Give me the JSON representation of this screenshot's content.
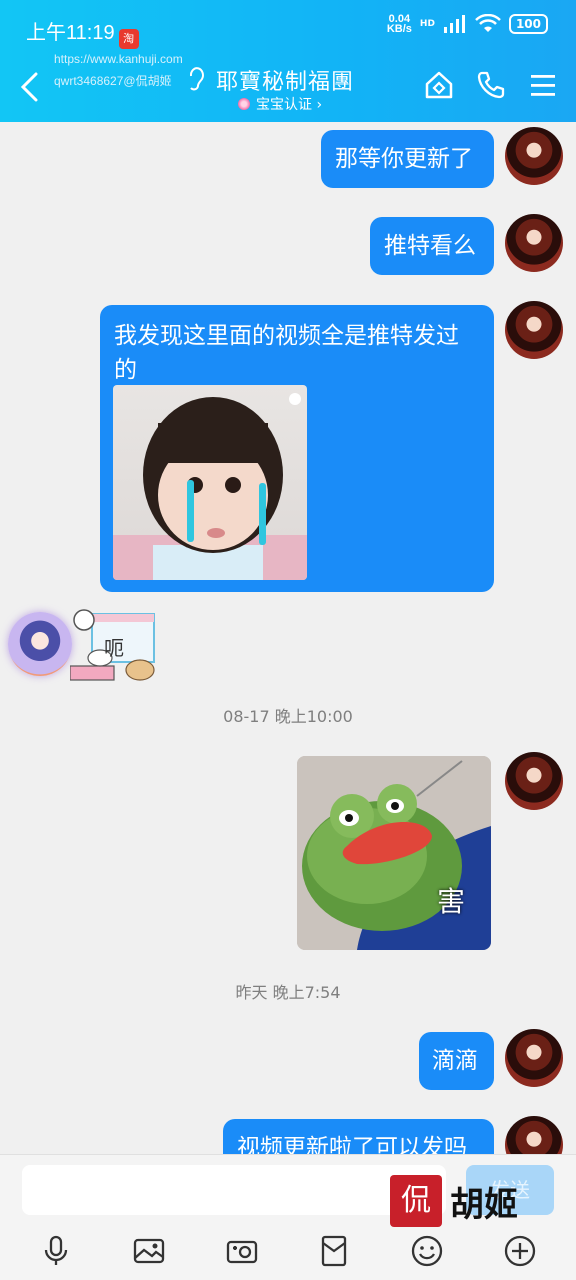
{
  "status_bar": {
    "time": "上午11:19",
    "badge": "淘",
    "net_speed_value": "0.04",
    "net_speed_unit": "KB/s",
    "signal_label": "HD",
    "battery": "100"
  },
  "watermark": {
    "url": "https://www.kanhuji.com",
    "user": "qwrt3468627@侃胡姬"
  },
  "header": {
    "title": "耶寶秘制福團",
    "subtitle": "宝宝认证 ›"
  },
  "messages": [
    {
      "text": "那等你更新了"
    },
    {
      "text": "推特看么"
    },
    {
      "text": "我发现这里面的视频全是推特发过的"
    },
    {
      "sticker_text": "呃"
    },
    {
      "time": "08-17 晚上10:00"
    },
    {
      "image_caption": "害"
    },
    {
      "time": "昨天 晚上7:54"
    },
    {
      "text": "滴滴"
    },
    {
      "text": "视频更新啦了可以发吗"
    }
  ],
  "input": {
    "send_label": "发送",
    "placeholder": ""
  },
  "brand_watermark": {
    "seal": "侃",
    "name": "胡姬"
  },
  "colors": {
    "header_start": "#12c6f5",
    "bubble": "#1a8cf8",
    "background": "#f0f0f0",
    "send_button": "#a9d6f8"
  },
  "icons": [
    "back-arrow-icon",
    "ear-icon",
    "home-icon",
    "phone-icon",
    "menu-icon",
    "microphone-icon",
    "image-icon",
    "camera-icon",
    "red-packet-icon",
    "emoji-icon",
    "plus-icon"
  ]
}
